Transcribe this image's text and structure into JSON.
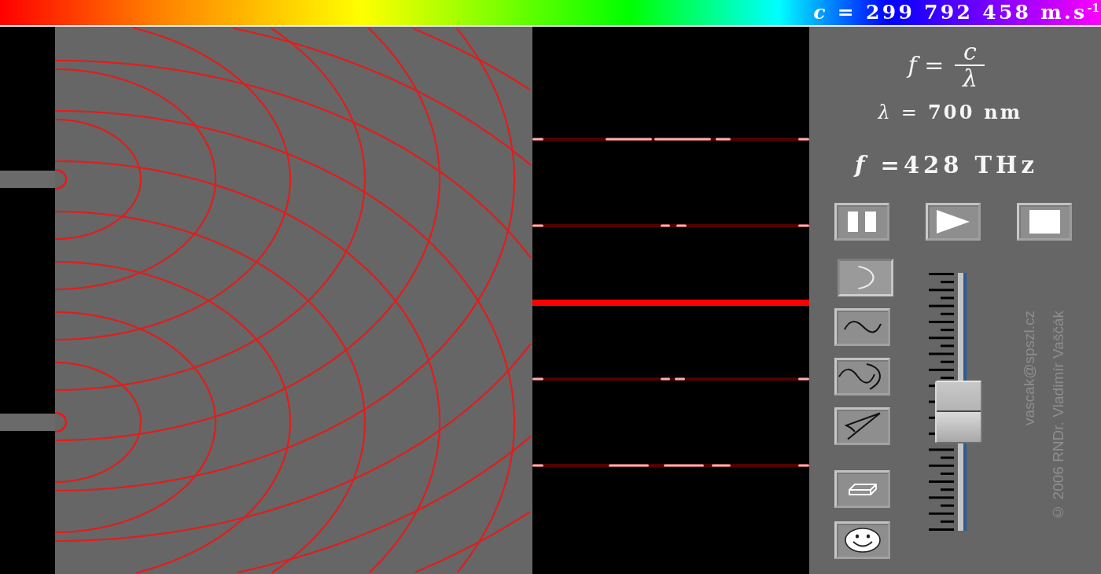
{
  "header": {
    "speed_of_light": "*c* = 299 792 458 m.s$^{-1}$"
  },
  "panel": {
    "formula": {
      "lhs": "*f* =",
      "numerator": "c",
      "denominator": "λ"
    },
    "wavelength": "*λ* = **700 nm**",
    "frequency": "*f* =428 THz",
    "playback": [
      {
        "kind": "pause"
      },
      {
        "kind": "play"
      },
      {
        "kind": "stop"
      }
    ],
    "tools": [
      {
        "kind": "arc",
        "selected": true
      },
      {
        "kind": "sine",
        "selected": false
      },
      {
        "kind": "sine-arc",
        "selected": false
      },
      {
        "kind": "angle",
        "selected": false
      }
    ],
    "actions": [
      {
        "kind": "eraser"
      },
      {
        "kind": "smiley"
      }
    ],
    "slider": {
      "level": 0.46
    },
    "credits": [
      "vascak@spszl.cz",
      "© 2006 RNDr. Vladimír Vaščák"
    ]
  }
}
